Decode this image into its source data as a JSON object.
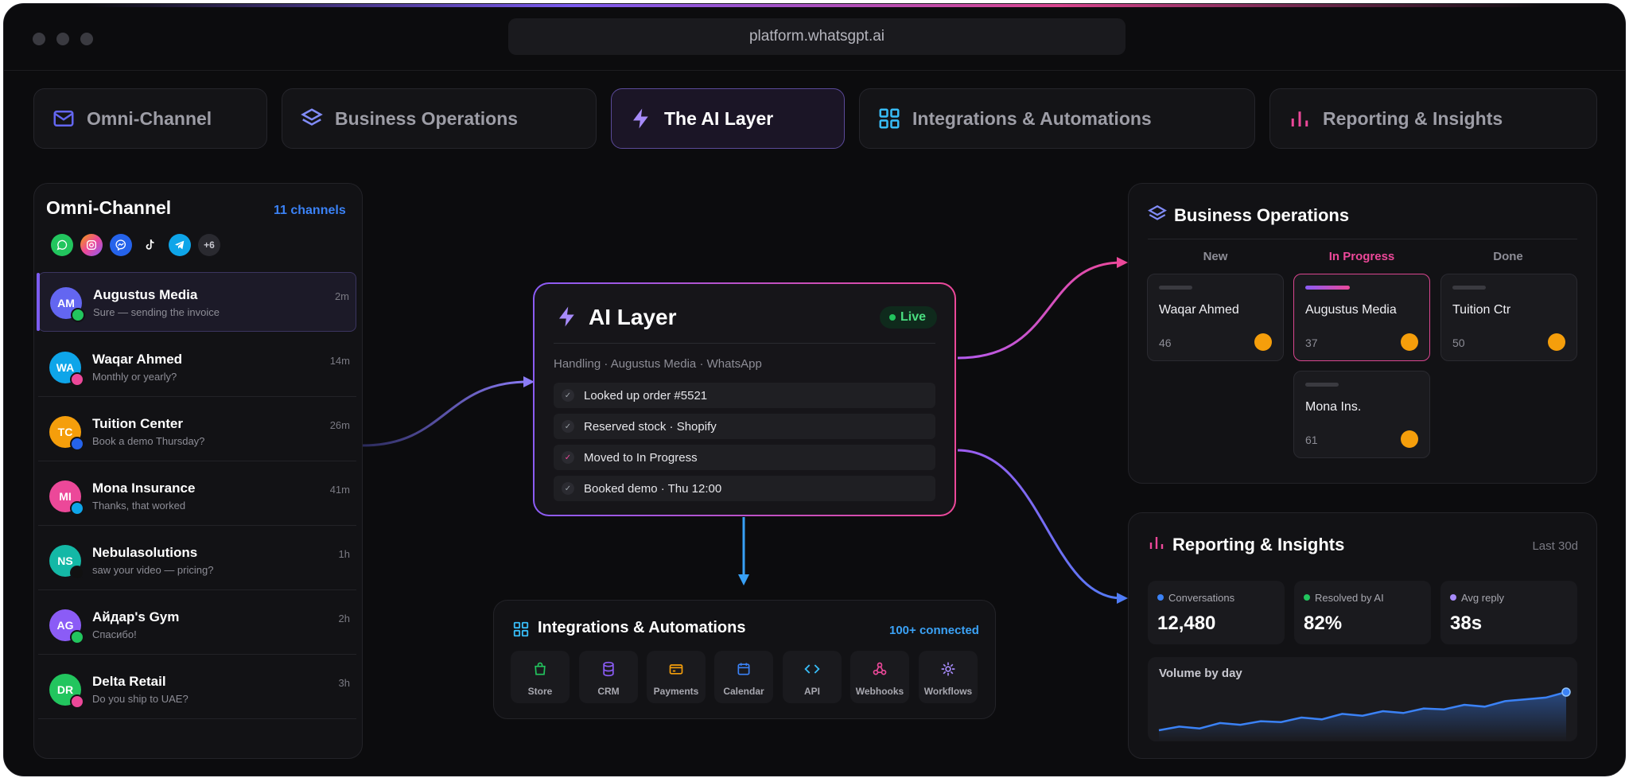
{
  "browser": {
    "url": "platform.whatsgpt.ai"
  },
  "tabs": [
    {
      "label": "Omni-Channel",
      "icon": "mail-icon",
      "color": "#6366f1"
    },
    {
      "label": "Business Operations",
      "icon": "layers-icon",
      "color": "#818cf8"
    },
    {
      "label": "The AI Layer",
      "icon": "bolt-icon",
      "color": "#a78bfa"
    },
    {
      "label": "Integrations & Automations",
      "icon": "grid-icon",
      "color": "#38bdf8"
    },
    {
      "label": "Reporting & Insights",
      "icon": "bar-chart-icon",
      "color": "#ec4899"
    }
  ],
  "omni": {
    "title": "Omni-Channel",
    "count": "11 channels",
    "more": "+6",
    "conversations": [
      {
        "initials": "AM",
        "name": "Augustus Media",
        "message": "Sure — sending the invoice",
        "time": "2m",
        "color": "#6366f1",
        "channel": "whatsapp"
      },
      {
        "initials": "WA",
        "name": "Waqar Ahmed",
        "message": "Monthly or yearly?",
        "time": "14m",
        "color": "#0ea5e9",
        "channel": "instagram"
      },
      {
        "initials": "TC",
        "name": "Tuition Center",
        "message": "Book a demo Thursday?",
        "time": "26m",
        "color": "#f59e0b",
        "channel": "messenger"
      },
      {
        "initials": "MI",
        "name": "Mona Insurance",
        "message": "Thanks, that worked",
        "time": "41m",
        "color": "#ec4899",
        "channel": "telegram"
      },
      {
        "initials": "NS",
        "name": "Nebulasolutions",
        "message": "saw your video — pricing?",
        "time": "1h",
        "color": "#14b8a6",
        "channel": "tiktok"
      },
      {
        "initials": "AG",
        "name": "Айдар's Gym",
        "message": "Спасибо!",
        "time": "2h",
        "color": "#8b5cf6",
        "channel": "whatsapp"
      },
      {
        "initials": "DR",
        "name": "Delta Retail",
        "message": "Do you ship to UAE?",
        "time": "3h",
        "color": "#22c55e",
        "channel": "instagram"
      }
    ]
  },
  "ai": {
    "title": "AI Layer",
    "status": "Live",
    "subtitle": "Handling · Augustus Media · WhatsApp",
    "steps": [
      "Looked up order #5521",
      "Reserved stock · Shopify",
      "Moved to In Progress",
      "Booked demo · Thu 12:00"
    ]
  },
  "integrations": {
    "title": "Integrations & Automations",
    "count": "100+ connected",
    "items": [
      {
        "label": "Store",
        "icon": "bag-icon",
        "color": "#22c55e"
      },
      {
        "label": "CRM",
        "icon": "database-icon",
        "color": "#8b5cf6"
      },
      {
        "label": "Payments",
        "icon": "card-icon",
        "color": "#f59e0b"
      },
      {
        "label": "Calendar",
        "icon": "calendar-icon",
        "color": "#3b82f6"
      },
      {
        "label": "API",
        "icon": "code-icon",
        "color": "#38bdf8"
      },
      {
        "label": "Webhooks",
        "icon": "webhook-icon",
        "color": "#ec4899"
      },
      {
        "label": "Workflows",
        "icon": "cog-icon",
        "color": "#a78bfa"
      }
    ]
  },
  "business": {
    "title": "Business Operations",
    "columns": [
      "New",
      "In Progress",
      "Done"
    ],
    "cards": [
      {
        "name": "Waqar Ahmed",
        "value": "46"
      },
      {
        "name": "Augustus Media",
        "value": "37"
      },
      {
        "name": "Tuition Ctr",
        "value": "50"
      },
      {
        "name": "Mona Ins.",
        "value": "61"
      }
    ]
  },
  "reporting": {
    "title": "Reporting & Insights",
    "range": "Last 30d",
    "stats": [
      {
        "label": "Conversations",
        "value": "12,480",
        "color": "#3b82f6"
      },
      {
        "label": "Resolved by AI",
        "value": "82%",
        "color": "#22c55e"
      },
      {
        "label": "Avg reply",
        "value": "38s",
        "color": "#a78bfa"
      }
    ],
    "chart_title": "Volume by day"
  },
  "chart_data": {
    "type": "area",
    "title": "Volume by day",
    "series": [
      {
        "values": [
          10,
          14,
          12,
          18,
          16,
          20,
          19,
          24,
          22,
          28,
          26,
          31,
          29,
          34,
          33,
          38,
          36,
          42,
          44,
          46,
          52
        ]
      }
    ]
  }
}
